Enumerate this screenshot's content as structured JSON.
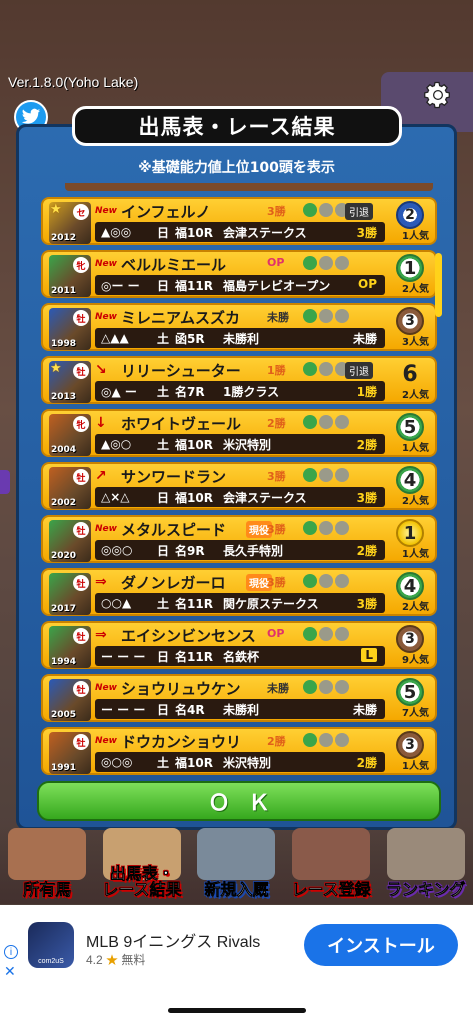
{
  "app": {
    "version": "Ver.1.8.0(Yoho Lake)"
  },
  "modal": {
    "title": "出馬表・レース結果",
    "subtitle": "※基礎能力値上位100頭を表示",
    "ok_label": "ＯＫ"
  },
  "horses": [
    {
      "trend": "New",
      "name": "インフェルノ",
      "sex": "セ",
      "year": "2012",
      "class": "3勝",
      "class_color": "orange",
      "tag": "",
      "inkai": "引退",
      "marks": "▲◎◎",
      "day": "日",
      "course": "福10R",
      "race": "会津ステークス",
      "result": "3勝",
      "rank": "2",
      "rank_style": "blue",
      "pop": "1人気",
      "star": true,
      "pic": "#d0a020"
    },
    {
      "trend": "New",
      "name": "ベルルミエール",
      "sex": "牝",
      "year": "2011",
      "class": "OP",
      "class_color": "pink",
      "tag": "",
      "inkai": "",
      "marks": "◎ー ー",
      "day": "日",
      "course": "福11R",
      "race": "福島テレビオープン",
      "result": "OP",
      "rank": "1",
      "rank_style": "green",
      "pop": "2人気",
      "star": false,
      "pic": "#3aa54a"
    },
    {
      "trend": "New",
      "name": "ミレニアムスズカ",
      "sex": "牡",
      "year": "1998",
      "class": "未勝",
      "class_color": "gray",
      "tag": "",
      "inkai": "",
      "marks": "△▲▲",
      "day": "土",
      "course": "函5R",
      "race": "未勝利",
      "result": "未勝",
      "rank": "3",
      "rank_style": "bronze",
      "pop": "3人気",
      "star": false,
      "pic": "#2a5ab8"
    },
    {
      "trend": "↘",
      "name": "リリーシューター",
      "sex": "牡",
      "year": "2013",
      "class": "1勝",
      "class_color": "orange",
      "tag": "",
      "inkai": "引退",
      "marks": "◎▲ ー",
      "day": "土",
      "course": "名7R",
      "race": "1勝クラス",
      "result": "1勝",
      "rank": "6",
      "rank_style": "plain",
      "pop": "2人気",
      "star": true,
      "pic": "#2a5ab8"
    },
    {
      "trend": "↓",
      "name": "ホワイトヴェール",
      "sex": "牝",
      "year": "2004",
      "class": "2勝",
      "class_color": "orange",
      "tag": "",
      "inkai": "",
      "marks": "▲◎○",
      "day": "土",
      "course": "福10R",
      "race": "米沢特別",
      "result": "2勝",
      "rank": "5",
      "rank_style": "green",
      "pop": "1人気",
      "star": false,
      "pic": "#c06020"
    },
    {
      "trend": "↗",
      "name": "サンワードラン",
      "sex": "牡",
      "year": "2002",
      "class": "3勝",
      "class_color": "orange",
      "tag": "",
      "inkai": "",
      "marks": "△×△",
      "day": "日",
      "course": "福10R",
      "race": "会津ステークス",
      "result": "3勝",
      "rank": "4",
      "rank_style": "green",
      "pop": "2人気",
      "star": false,
      "pic": "#c06020"
    },
    {
      "trend": "New",
      "name": "メタルスピード",
      "sex": "牡",
      "year": "2020",
      "class": "3勝",
      "class_color": "orange",
      "tag": "現役",
      "inkai": "",
      "marks": "◎◎○",
      "day": "日",
      "course": "名9R",
      "race": "長久手特別",
      "result": "2勝",
      "rank": "1",
      "rank_style": "gold",
      "pop": "1人気",
      "star": false,
      "pic": "#3aa54a"
    },
    {
      "trend": "⇒",
      "name": "ダノンレガーロ",
      "sex": "牡",
      "year": "2017",
      "class": "3勝",
      "class_color": "orange",
      "tag": "現役",
      "inkai": "",
      "marks": "○○▲",
      "day": "土",
      "course": "名11R",
      "race": "関ケ原ステークス",
      "result": "3勝",
      "rank": "4",
      "rank_style": "green",
      "pop": "2人気",
      "star": false,
      "pic": "#3aa54a"
    },
    {
      "trend": "⇒",
      "name": "エイシンビンセンス",
      "sex": "牡",
      "year": "1994",
      "class": "OP",
      "class_color": "pink",
      "tag": "",
      "inkai": "",
      "marks": "ー ー ー",
      "day": "日",
      "course": "名11R",
      "race": "名鉄杯",
      "result": "L",
      "rank": "3",
      "rank_style": "bronze",
      "pop": "9人気",
      "star": false,
      "pic": "#3aa54a"
    },
    {
      "trend": "New",
      "name": "ショウリュウケン",
      "sex": "牡",
      "year": "2005",
      "class": "未勝",
      "class_color": "gray",
      "tag": "",
      "inkai": "",
      "marks": "ー ー ー",
      "day": "日",
      "course": "名4R",
      "race": "未勝利",
      "result": "未勝",
      "rank": "5",
      "rank_style": "green",
      "pop": "7人気",
      "star": false,
      "pic": "#2a5ab8"
    },
    {
      "trend": "New",
      "name": "ドウカンショウリ",
      "sex": "牡",
      "year": "1991",
      "class": "2勝",
      "class_color": "orange",
      "tag": "",
      "inkai": "",
      "marks": "◎○◎",
      "day": "土",
      "course": "福10R",
      "race": "米沢特別",
      "result": "2勝",
      "rank": "3",
      "rank_style": "bronze",
      "pop": "1人気",
      "star": false,
      "pic": "#c06020"
    }
  ],
  "bottom_nav": [
    {
      "label": "所有馬",
      "style": "red",
      "bg": "#a87050"
    },
    {
      "label": "出馬表・\nレース結果",
      "style": "red",
      "bg": "#c8a070"
    },
    {
      "label": "新規入厩",
      "style": "blue",
      "bg": "#7a8a9a"
    },
    {
      "label": "レース登録",
      "style": "red",
      "bg": "#8a5a4a"
    },
    {
      "label": "ランキング",
      "style": "purple",
      "bg": "#9a8a7a"
    }
  ],
  "ad": {
    "app_name": "MLB 9イニングス Rivals",
    "rating": "4.2",
    "price": "無料",
    "install_label": "インストール",
    "icon_text": "com2uS"
  }
}
